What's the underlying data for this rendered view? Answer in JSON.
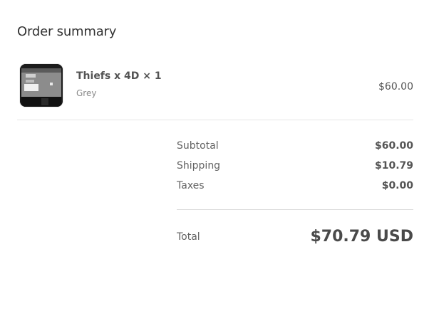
{
  "summary": {
    "title": "Order summary"
  },
  "item": {
    "name": "Thiefs x 4D × 1",
    "variant": "Grey",
    "price": "$60.00"
  },
  "totals": {
    "subtotal_label": "Subtotal",
    "subtotal_value": "$60.00",
    "shipping_label": "Shipping",
    "shipping_value": "$10.79",
    "taxes_label": "Taxes",
    "taxes_value": "$0.00",
    "total_label": "Total",
    "total_value": "$70.79 USD"
  }
}
